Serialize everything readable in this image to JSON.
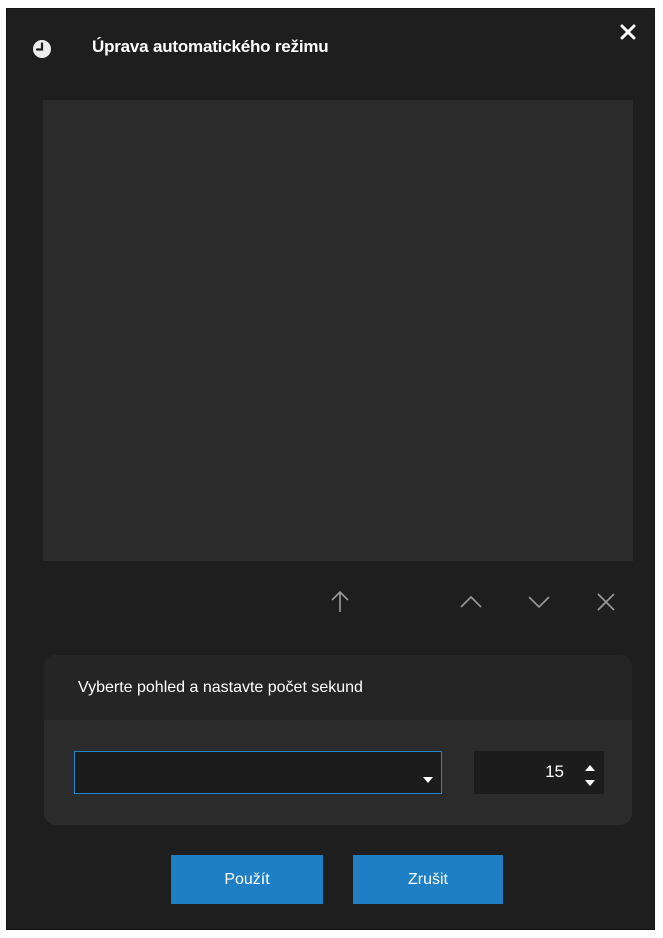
{
  "dialog": {
    "title": "Úprava automatického režimu",
    "icons": {
      "title": "clock-icon",
      "close": "close-icon"
    }
  },
  "view_list": {
    "items": []
  },
  "toolbar": {
    "items": [
      {
        "name": "move-to-top",
        "icon": "arrow-up-icon"
      },
      {
        "name": "move-up",
        "icon": "chevron-up-icon"
      },
      {
        "name": "move-down",
        "icon": "chevron-down-icon"
      },
      {
        "name": "remove",
        "icon": "close-icon"
      }
    ]
  },
  "panel": {
    "header": "Vyberte pohled a nastavte počet sekund",
    "view_select": {
      "value": ""
    },
    "seconds": {
      "value": "15"
    }
  },
  "buttons": {
    "apply": "Použít",
    "cancel": "Zrušit"
  },
  "colors": {
    "accent": "#1f7fc4",
    "focus_border": "#1e86cf",
    "background": "#1e1e1e",
    "list_background": "#2b2b2b",
    "text": "#ffffff",
    "icon_muted": "#9a9a9a"
  }
}
